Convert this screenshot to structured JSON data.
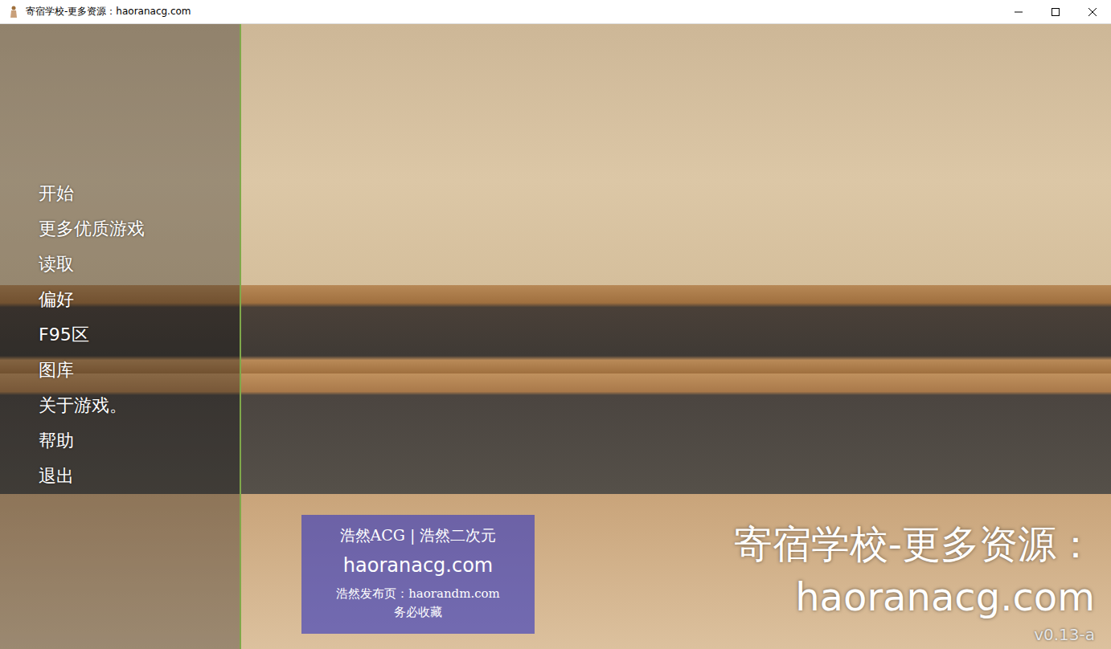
{
  "window": {
    "title": "寄宿学校-更多资源：haoranacg.com"
  },
  "menu": {
    "items": [
      {
        "label": "开始"
      },
      {
        "label": "更多优质游戏"
      },
      {
        "label": "读取"
      },
      {
        "label": "偏好"
      },
      {
        "label": "F95区"
      },
      {
        "label": "图库"
      },
      {
        "label": "关于游戏。"
      },
      {
        "label": "帮助"
      },
      {
        "label": "退出"
      }
    ]
  },
  "caption": {
    "lines": [
      "寄宿学校-更多资源：",
      "haoranacg.com"
    ]
  },
  "version": "v0.13-a",
  "watermark": {
    "lines": [
      "浩然ACG | 浩然二次元",
      "haoranacg.com",
      "浩然发布页：haorandm.com",
      "务必收藏"
    ]
  }
}
